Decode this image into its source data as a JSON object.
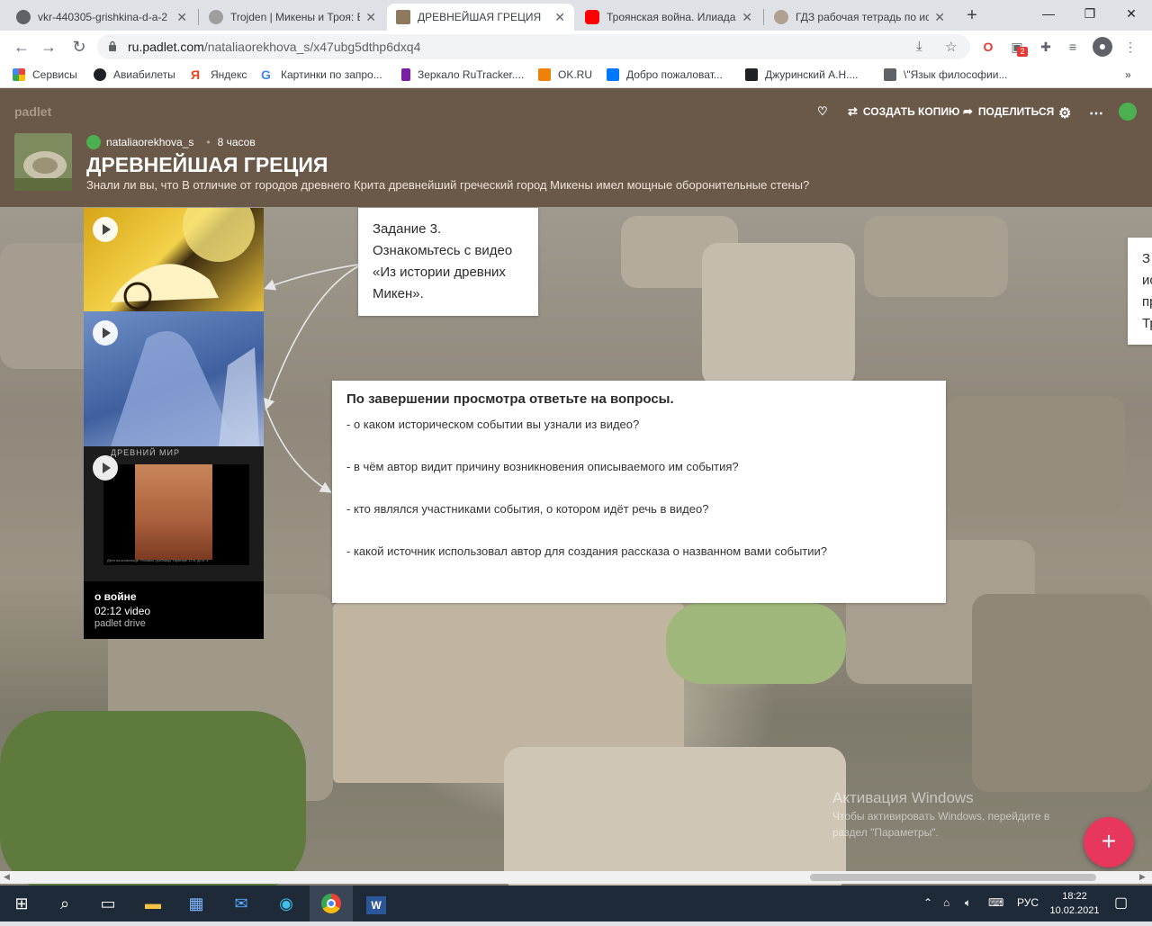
{
  "browser": {
    "tabs": [
      {
        "title": "vkr-440305-grishkina-d-a-2",
        "favicon_color": "#5f6368",
        "active": false
      },
      {
        "title": "Trojden | Микены и Троя: В",
        "favicon_color": "#9e9e9e",
        "active": false
      },
      {
        "title": "ДРЕВНЕЙШАЯ ГРЕЦИЯ",
        "favicon_color": "#8d7a5c",
        "active": true
      },
      {
        "title": "Троянская война. Илиада.",
        "favicon_color": "#ff0000",
        "active": false
      },
      {
        "title": "ГДЗ рабочая тетрадь по ис",
        "favicon_color": "#b0a090",
        "active": false
      }
    ],
    "new_tab": "+",
    "window_controls": {
      "minimize": "—",
      "restore": "❐",
      "close": "✕"
    },
    "nav": {
      "back": "←",
      "forward": "→",
      "reload": "↻"
    },
    "url_host": "ru.padlet.com",
    "url_path": "/nataliaorekhova_s/x47ubg5dthp6dxq4",
    "extension_badge": "2",
    "bookmarks": [
      {
        "label": "Сервисы",
        "color": "#ea4335"
      },
      {
        "label": "Авиабилеты",
        "color": "#202124"
      },
      {
        "label": "Яндекс",
        "color": "#fc3f1d"
      },
      {
        "label": "Картинки по запро...",
        "color": "#4285f4"
      },
      {
        "label": "Зеркало RuTracker....",
        "color": "#7b1fa2"
      },
      {
        "label": "OK.RU",
        "color": "#ee8208"
      },
      {
        "label": "Добро пожаловат...",
        "color": "#0077ff"
      },
      {
        "label": "Джуринский А.Н....",
        "color": "#202124"
      },
      {
        "label": "\\\"Язык философии...",
        "color": "#5f6368"
      }
    ],
    "bookmarks_more": "»"
  },
  "padlet": {
    "logo": "padlet",
    "create_copy": "СОЗДАТЬ КОПИЮ",
    "share": "ПОДЕЛИТЬСЯ",
    "author": "nataliaorekhova_s",
    "time_ago": "8 часов",
    "title": "ДРЕВНЕЙШАЯ ГРЕЦИЯ",
    "description": "Знали ли вы, что В отличие от городов древнего Крита древнейший греческий город Микены имел мощные оборонительные стены?",
    "header_color": "#6a5848",
    "task_card": "Задание 3. Ознакомьтесь с видео «Из истории древних Микен».",
    "questions": {
      "title": "По завершении просмотра ответьте на вопросы.",
      "items": [
        "- о каком историческом событии вы узнали из видео?",
        "- в чём автор видит причину возникновения описываемого им события?",
        "- кто являлся участниками события, о котором идёт речь в видео?",
        "- какой источник использовал автор для создания рассказа о названном вами событии?"
      ]
    },
    "partial_card_lines": [
      "З",
      "ис",
      "пр",
      "Тр"
    ],
    "video_card": {
      "screen_title": "ДРЕВНИЙ МИР",
      "screen_caption": "Дети на колеснице. Роспись гробницы Тиринфе 13 в. до н. э.",
      "title": "о войне",
      "meta": "02:12 video",
      "source": "padlet drive"
    },
    "fab": "+",
    "accent_color": "#e8375c"
  },
  "watermark": {
    "line1": "Активация Windows",
    "line2": "Чтобы активировать Windows, перейдите в",
    "line3": "раздел \"Параметры\"."
  },
  "taskbar": {
    "language": "РУС",
    "time": "18:22",
    "date": "10.02.2021"
  }
}
